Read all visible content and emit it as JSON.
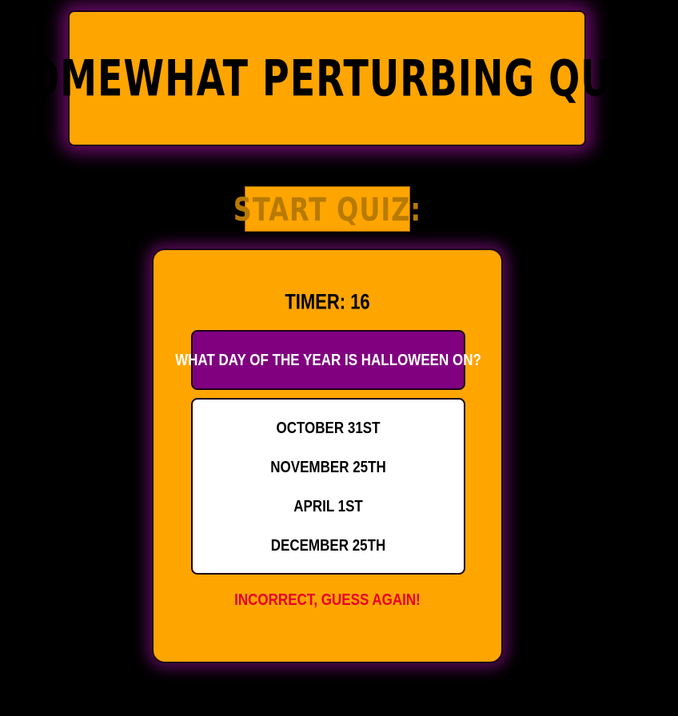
{
  "header": {
    "title": "Somewhat Perturbing Quiz"
  },
  "start": {
    "label": "Start Quiz:"
  },
  "quiz": {
    "timer": "Timer: 16",
    "question": "What day of the year is Halloween on?",
    "answers": [
      {
        "label": "October 31st"
      },
      {
        "label": "November 25th"
      },
      {
        "label": "April 1st"
      },
      {
        "label": "December 25th"
      }
    ],
    "feedback": "Incorrect, guess again!"
  },
  "colors": {
    "background": "#000000",
    "accent": "#ffa500",
    "question_bg": "#800080",
    "glow": "#6a0a6a",
    "feedback": "#e8002a"
  }
}
